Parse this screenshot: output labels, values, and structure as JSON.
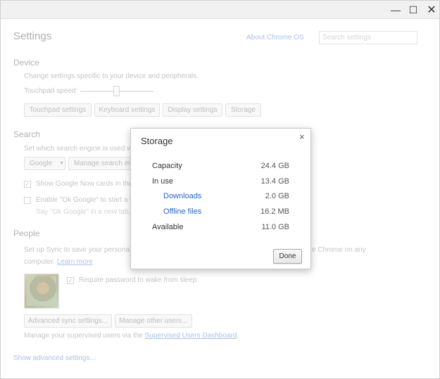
{
  "window": {
    "minimize_glyph": "—",
    "maximize_glyph": "☐",
    "close_glyph": "✕"
  },
  "settings": {
    "title": "Settings",
    "about_link": "About Chrome OS",
    "search_placeholder": "Search settings",
    "device": {
      "title": "Device",
      "description": "Change settings specific to your device and peripherals.",
      "touchpad_speed_label": "Touchpad speed:",
      "buttons": [
        "Touchpad settings",
        "Keyboard settings",
        "Display settings",
        "Storage"
      ]
    },
    "search": {
      "title": "Search",
      "description": "Set which search engine is used wh",
      "engine_select": "Google",
      "manage_button": "Manage search eng",
      "google_now_checkbox": "Show Google Now cards in the l",
      "ok_google_checkbox": "Enable \"Ok Google\" to start a vo",
      "ok_google_hint": "Say \"Ok Google\" in a new tab, g"
    },
    "people": {
      "title": "People",
      "sync_text": "Set up Sync to save your personaliz",
      "sync_text_right": "e Chrome on any",
      "computer_text": "computer.",
      "learn_more": "Learn more",
      "require_password": "Require password to wake from sleep",
      "advanced_sync_button": "Advanced sync settings...",
      "manage_users_button": "Manage other users...",
      "supervised_text": "Manage your supervised users via the",
      "supervised_link": "Supervised Users Dashboard",
      "supervised_end": "."
    },
    "show_advanced": "Show advanced settings..."
  },
  "dialog": {
    "title": "Storage",
    "close_glyph": "×",
    "rows": [
      {
        "label": "Capacity",
        "value": "24.4 GB"
      },
      {
        "label": "In use",
        "value": "13.4 GB"
      },
      {
        "label": "Downloads",
        "value": "2.0 GB"
      },
      {
        "label": "Offline files",
        "value": "16.2 MB"
      },
      {
        "label": "Available",
        "value": "11.0 GB"
      }
    ],
    "done_label": "Done"
  }
}
